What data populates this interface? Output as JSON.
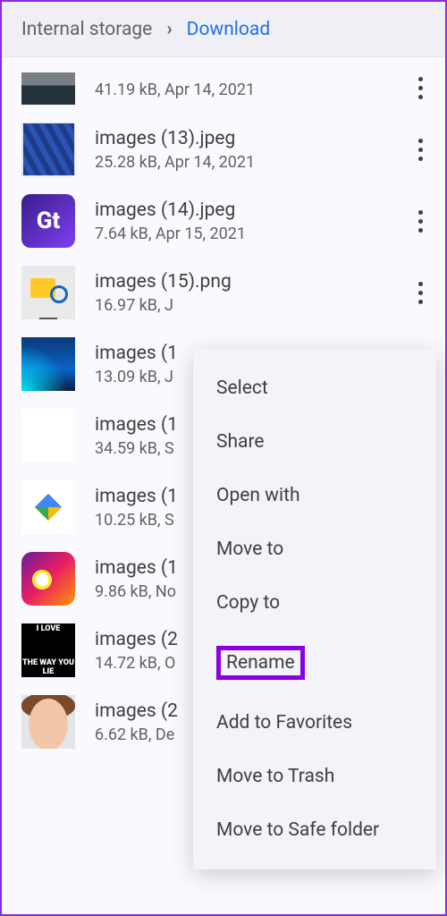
{
  "breadcrumb": {
    "parent": "Internal storage",
    "current": "Download"
  },
  "files": [
    {
      "name": "",
      "meta": "41.19 kB, Apr 14, 2021"
    },
    {
      "name": "images (13).jpeg",
      "meta": "25.28 kB, Apr 14, 2021"
    },
    {
      "name": "images (14).jpeg",
      "meta": "7.64 kB, Apr 15, 2021"
    },
    {
      "name": "images (15).png",
      "meta": "16.97 kB, J"
    },
    {
      "name": "images (1",
      "meta": "13.09 kB, J"
    },
    {
      "name": "images (1",
      "meta": "34.59 kB, S"
    },
    {
      "name": "images (1",
      "meta": "10.25 kB, S"
    },
    {
      "name": "images (1",
      "meta": "9.86 kB, No"
    },
    {
      "name": "images (2",
      "meta": "14.72 kB, O"
    },
    {
      "name": "images (2",
      "meta": "6.62 kB, De"
    }
  ],
  "menu": {
    "select": "Select",
    "share": "Share",
    "open_with": "Open with",
    "move_to": "Move to",
    "copy_to": "Copy to",
    "rename": "Rename",
    "add_fav": "Add to Favorites",
    "trash": "Move to Trash",
    "safe": "Move to Safe folder"
  },
  "meme": {
    "top": "I LOVE",
    "bottom": "THE WAY YOU LIE"
  }
}
